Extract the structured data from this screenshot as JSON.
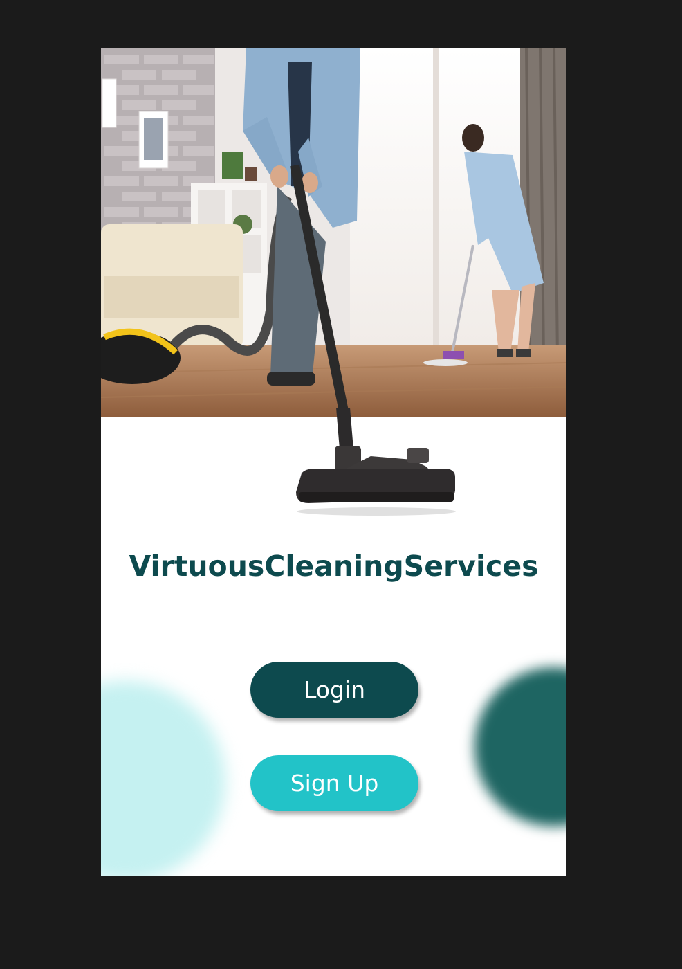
{
  "app": {
    "brand_name": "VirtuousCleaningServices"
  },
  "hero": {
    "image_subject": "cleaning-photo"
  },
  "actions": {
    "login_label": "Login",
    "signup_label": "Sign Up"
  },
  "colors": {
    "primary_dark": "#0d4a4e",
    "primary_accent": "#22c3c8",
    "blob_light": "#c5f1f1",
    "blob_dark": "#1e6562",
    "frame_bg": "#1b1b1b"
  }
}
